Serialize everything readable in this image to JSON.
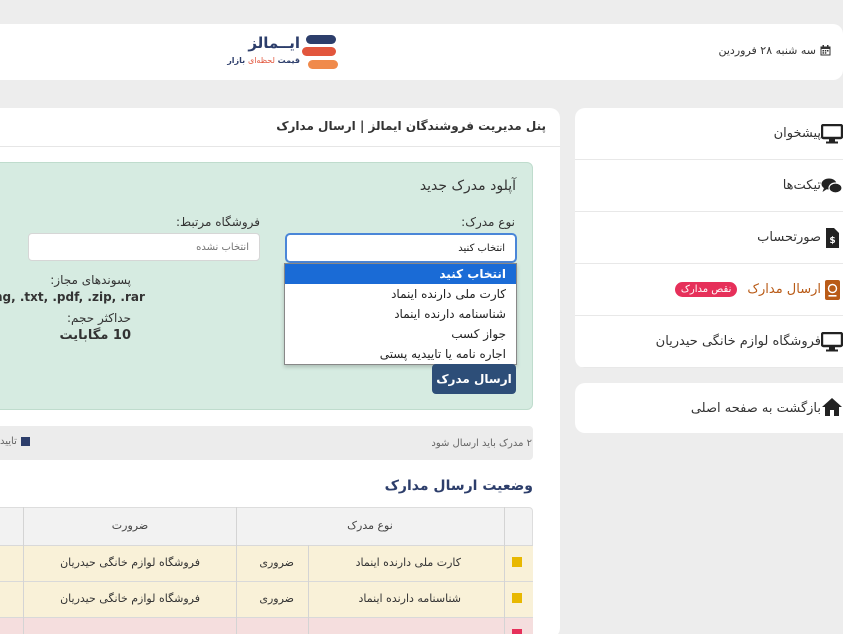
{
  "header": {
    "date": "سه شنبه ۲۸ فروردین",
    "logo_name": "ایــمالز",
    "logo_tagline_prefix": "قیمت ",
    "logo_tagline_highlight": "لحظه‌ای",
    "logo_tagline_suffix": " بازار"
  },
  "sidebar": {
    "items": [
      {
        "label": "پیشخوان",
        "icon": "monitor-icon"
      },
      {
        "label": "تیکت‌ها",
        "icon": "chat-icon"
      },
      {
        "label": "صورتحساب",
        "icon": "invoice-icon"
      },
      {
        "label": "ارسال مدارک",
        "icon": "passport-icon",
        "badge": "نقص مدارک"
      },
      {
        "label": "فروشگاه لوازم خانگی حیدریان",
        "icon": "monitor-icon"
      }
    ],
    "back_label": "بازگشت به صفحه اصلی"
  },
  "panel": {
    "title": "پنل مدیریت فروشندگان ایمالز | ارسال مدارک"
  },
  "upload": {
    "title": "آپلود مدرک جدید",
    "doc_type_label": "نوع مدرک:",
    "store_label": "فروشگاه مرتبط:",
    "store_placeholder": "انتخاب نشده",
    "selected_value": "انتخاب کنید",
    "options": [
      "انتخاب کنید",
      "کارت ملی دارنده اینماد",
      "شناسنامه دارنده اینماد",
      "جواز کسب",
      "اجاره نامه یا تاییدیه پستی"
    ],
    "ext_label": "پسوندهای مجاز:",
    "ext_value": "ng, .txt, .pdf, .zip, .rar",
    "size_label": "حداکثر حجم:",
    "size_value": "10 مگابایت",
    "submit_label": "ارسال مدرک"
  },
  "notice": {
    "text": "۲ مدرک باید ارسال شود",
    "legend": "تایید"
  },
  "status": {
    "title": "وضعیت ارسال مدارک",
    "columns": {
      "doc_type": "نوع مدرک",
      "necessity": "ضرورت"
    },
    "rows": [
      {
        "doc": "کارت ملی دارنده اینماد",
        "required": "ضروری",
        "store": "فروشگاه لوازم خانگی حیدریان",
        "color": "#e8b800",
        "bg": "#f9f1d8"
      },
      {
        "doc": "شناسنامه دارنده اینماد",
        "required": "ضروری",
        "store": "فروشگاه لوازم خانگی حیدریان",
        "color": "#e8b800",
        "bg": "#f9f1d8"
      },
      {
        "doc": "",
        "required": "",
        "store": "",
        "color": "#e6305a",
        "bg": "#f5dede"
      }
    ]
  }
}
